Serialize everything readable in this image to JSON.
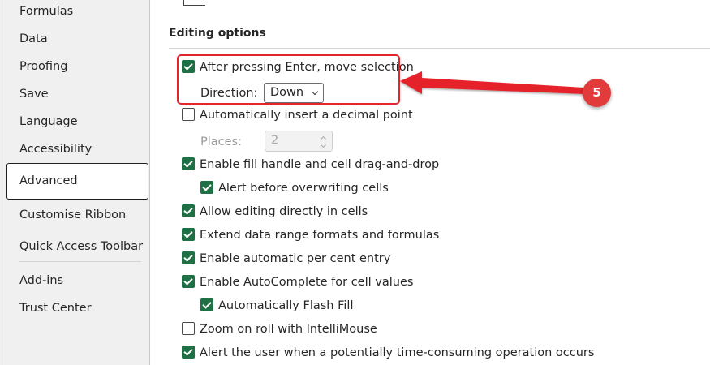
{
  "sidebar": {
    "items": [
      {
        "label": "Formulas"
      },
      {
        "label": "Data"
      },
      {
        "label": "Proofing"
      },
      {
        "label": "Save"
      },
      {
        "label": "Language"
      },
      {
        "label": "Accessibility"
      },
      {
        "label": "Advanced",
        "selected": true
      },
      {
        "label": "Customise Ribbon"
      },
      {
        "label": "Quick Access Toolbar"
      },
      {
        "label": "Add-ins"
      },
      {
        "label": "Trust Center"
      }
    ]
  },
  "main": {
    "section_title": "Editing options",
    "options": {
      "move_after_enter": {
        "label": "After pressing Enter, move selection",
        "checked": true
      },
      "direction": {
        "label": "Direction:",
        "value": "Down"
      },
      "decimal_point": {
        "label": "Automatically insert a decimal point",
        "checked": false
      },
      "places": {
        "label": "Places:",
        "value": "2"
      },
      "fill_handle": {
        "label": "Enable fill handle and cell drag-and-drop",
        "checked": true
      },
      "alert_overwrite": {
        "label": "Alert before overwriting cells",
        "checked": true
      },
      "edit_in_cells": {
        "label": "Allow editing directly in cells",
        "checked": true
      },
      "extend_formats": {
        "label": "Extend data range formats and formulas",
        "checked": true
      },
      "percent_entry": {
        "label": "Enable automatic per cent entry",
        "checked": true
      },
      "autocomplete": {
        "label": "Enable AutoComplete for cell values",
        "checked": true
      },
      "flash_fill": {
        "label": "Automatically Flash Fill",
        "checked": true
      },
      "zoom_roll": {
        "label": "Zoom on roll with IntelliMouse",
        "checked": false
      },
      "alert_time": {
        "label": "Alert the user when a potentially time-consuming operation occurs",
        "checked": true
      }
    }
  },
  "annotation": {
    "number": "5",
    "color": "#e23b3b"
  },
  "colors": {
    "checkbox_checked": "#1f7145",
    "highlight": "#e5242b"
  },
  "icons": [
    "checkmark-icon",
    "chevron-down-icon",
    "spinner-arrows-icon"
  ]
}
